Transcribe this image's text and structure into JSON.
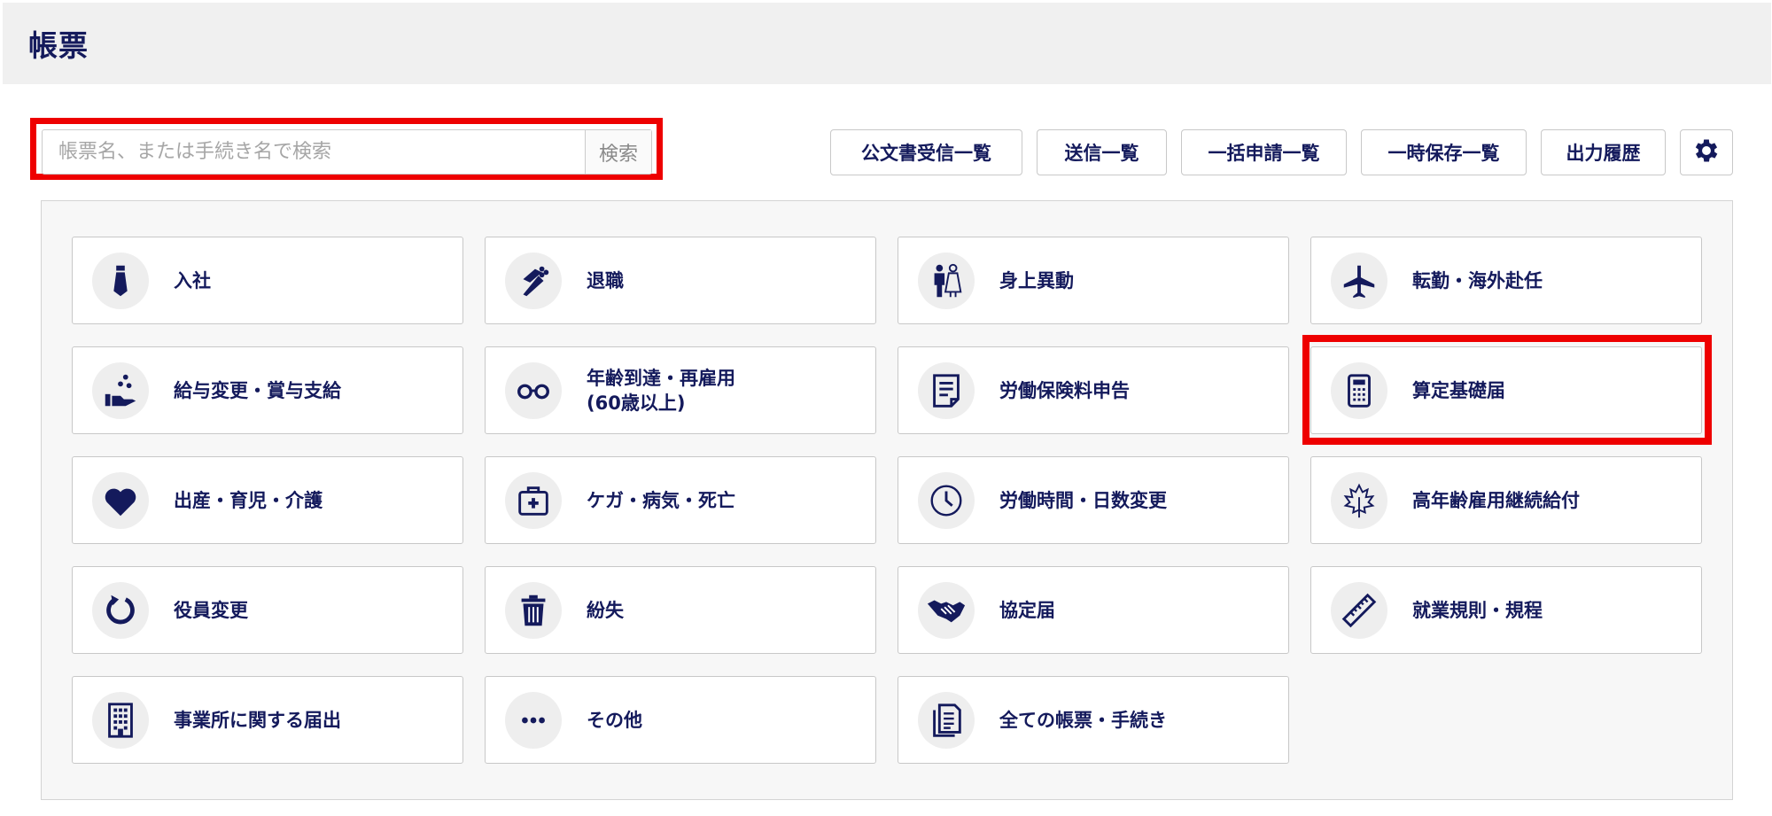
{
  "header": {
    "title": "帳票"
  },
  "search": {
    "placeholder": "帳票名、または手続き名で検索",
    "value": "",
    "button_label": "検索"
  },
  "toolbar": {
    "buttons": [
      {
        "label": "公文書受信一覧"
      },
      {
        "label": "送信一覧"
      },
      {
        "label": "一括申請一覧"
      },
      {
        "label": "一時保存一覧"
      },
      {
        "label": "出力履歴"
      }
    ],
    "settings_icon": "gear-icon"
  },
  "categories": [
    {
      "label": "入社",
      "icon": "necktie-icon"
    },
    {
      "label": "退職",
      "icon": "bouquet-icon"
    },
    {
      "label": "身上異動",
      "icon": "couple-icon"
    },
    {
      "label": "転勤・海外赴任",
      "icon": "airplane-icon"
    },
    {
      "label": "給与変更・賞与支給",
      "icon": "hand-coins-icon"
    },
    {
      "label": "年齢到達・再雇用\n(60歳以上)",
      "icon": "glasses-icon"
    },
    {
      "label": "労働保険料申告",
      "icon": "document-icon"
    },
    {
      "label": "算定基礎届",
      "icon": "calculator-icon"
    },
    {
      "label": "出産・育児・介護",
      "icon": "heart-icon"
    },
    {
      "label": "ケガ・病気・死亡",
      "icon": "first-aid-kit-icon"
    },
    {
      "label": "労働時間・日数変更",
      "icon": "clock-icon"
    },
    {
      "label": "高年齢雇用継続給付",
      "icon": "maple-leaf-icon"
    },
    {
      "label": "役員変更",
      "icon": "refresh-icon"
    },
    {
      "label": "紛失",
      "icon": "trash-icon"
    },
    {
      "label": "協定届",
      "icon": "handshake-icon"
    },
    {
      "label": "就業規則・規程",
      "icon": "ruler-icon"
    },
    {
      "label": "事業所に関する届出",
      "icon": "building-icon"
    },
    {
      "label": "その他",
      "icon": "ellipsis-icon"
    },
    {
      "label": "全ての帳票・手続き",
      "icon": "documents-icon"
    }
  ],
  "colors": {
    "text": "#141a5c",
    "highlight": "#ee0000",
    "header_bg": "#f0f0f0"
  }
}
